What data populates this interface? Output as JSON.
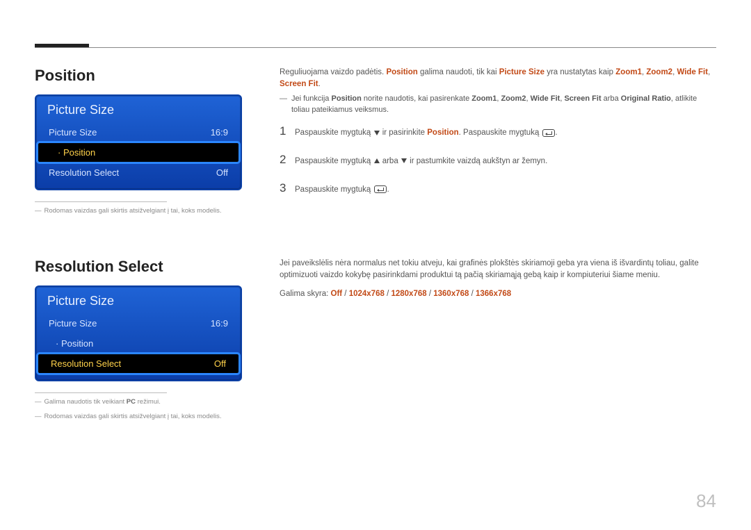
{
  "page_number": "84",
  "section1": {
    "title": "Position",
    "menu": {
      "title": "Picture Size",
      "rows": [
        {
          "label": "Picture Size",
          "value": "16:9",
          "indent": false
        },
        {
          "label": "Position",
          "value": "",
          "indent": true,
          "selected": true
        },
        {
          "label": "Resolution Select",
          "value": "Off",
          "indent": false
        }
      ]
    },
    "footnote": "Rodomas vaizdas gali skirtis atsižvelgiant į tai, koks modelis.",
    "intro_parts": {
      "p1a": "Reguliuojama vaizdo padėtis. ",
      "p1b": "Position",
      "p1c": " galima naudoti, tik kai ",
      "p1d": "Picture Size",
      "p1e": " yra nustatytas kaip ",
      "p1f": "Zoom1",
      "p1g": ", ",
      "p1h": "Zoom2",
      "p1i": ", ",
      "p1j": "Wide Fit",
      "p1k": ", ",
      "p1l": "Screen Fit",
      "p1m": "."
    },
    "note": {
      "a": "Jei funkcija ",
      "b": "Position",
      "c": " norite naudotis, kai pasirenkate ",
      "d": "Zoom1",
      "e": ", ",
      "f": "Zoom2",
      "g": ", ",
      "h": "Wide Fit",
      "i": ", ",
      "j": "Screen Fit",
      "k": " arba ",
      "l": "Original Ratio",
      "m": ", atlikite toliau pateikiamus veiksmus."
    },
    "steps": {
      "s1a": "Paspauskite mygtuką ",
      "s1b": " ir pasirinkite ",
      "s1c": "Position",
      "s1d": ". Paspauskite mygtuką ",
      "s1e": ".",
      "s2a": "Paspauskite mygtuką ",
      "s2b": " arba ",
      "s2c": " ir pastumkite vaizdą aukštyn ar žemyn.",
      "s3a": "Paspauskite mygtuką ",
      "s3b": "."
    }
  },
  "section2": {
    "title": "Resolution Select",
    "menu": {
      "title": "Picture Size",
      "rows": [
        {
          "label": "Picture Size",
          "value": "16:9",
          "indent": false
        },
        {
          "label": "Position",
          "value": "",
          "indent": true
        },
        {
          "label": "Resolution Select",
          "value": "Off",
          "indent": false,
          "selected": true
        }
      ]
    },
    "footnote1_a": "Galima naudotis tik veikiant ",
    "footnote1_b": "PC",
    "footnote1_c": " režimui.",
    "footnote2": "Rodomas vaizdas gali skirtis atsižvelgiant į tai, koks modelis.",
    "intro": "Jei paveikslėlis nėra normalus net tokiu atveju, kai grafinės plokštės skiriamoji geba yra viena iš išvardintų toliau, galite optimizuoti vaizdo kokybę pasirinkdami produktui tą pačią skiriamąją gebą kaip ir kompiuteriui šiame meniu.",
    "res_line": {
      "a": "Galima skyra: ",
      "b": "Off",
      "c": "1024x768",
      "d": "1280x768",
      "e": "1360x768",
      "f": "1366x768"
    }
  }
}
